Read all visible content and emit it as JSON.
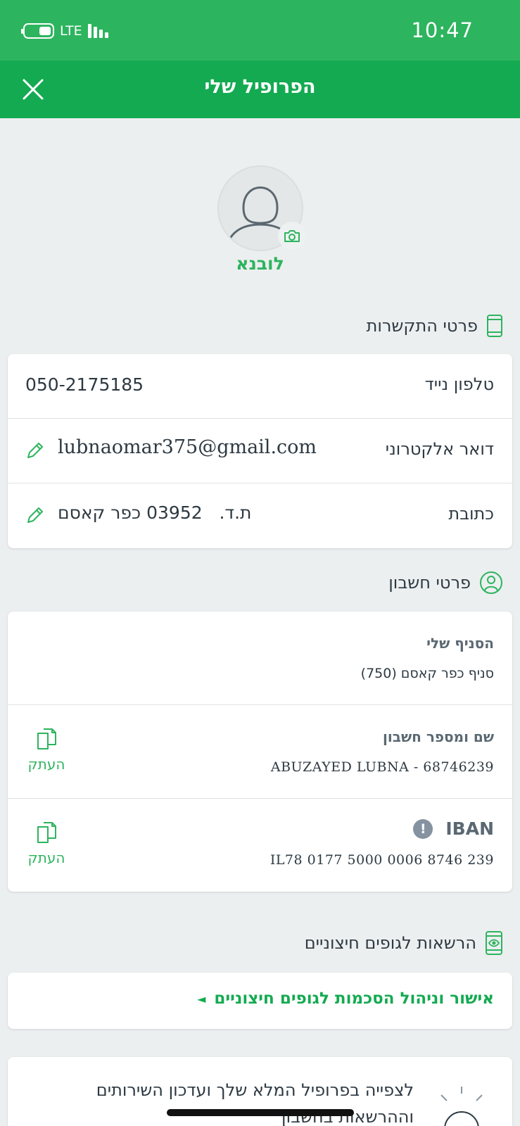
{
  "status_bar": {
    "network": "LTE",
    "time": "10:47"
  },
  "header": {
    "title": "הפרופיל שלי",
    "close_icon": "close-icon"
  },
  "profile": {
    "name": "לובנא",
    "avatar_icon": "user-silhouette-icon",
    "camera_icon": "camera-icon"
  },
  "contact_section": {
    "title": "פרטי התקשרות",
    "icon": "phone-icon",
    "rows": [
      {
        "label": "טלפון נייד",
        "value": "050-2175185"
      },
      {
        "label": "דואר אלקטרוני",
        "value": "lubnaomar375@gmail.com",
        "editable": true
      },
      {
        "label": "כתובת",
        "value": "ת.ד.   03952 כפר קאסם",
        "editable": true
      }
    ]
  },
  "account_section": {
    "title": "פרטי חשבון",
    "icon": "user-circle-icon",
    "branch_label": "הסניף שלי",
    "branch_value": "סניף כפר קאסם (750)",
    "account_label": "שם ומספר חשבון",
    "account_value": "ABUZAYED LUBNA - 68746239",
    "iban_label": "IBAN",
    "iban_value": "IL78 0177 5000 0006 8746 239",
    "info_symbol": "!",
    "copy_label": "העתק"
  },
  "permissions_section": {
    "title": "הרשאות לגופים חיצוניים",
    "icon": "phone-eye-icon",
    "link": "אישור וניהול הסכמות לגופים חיצוניים",
    "link_arrow": "◄"
  },
  "bottom_card": {
    "text": "לצפייה בפרופיל המלא שלך ועדכון השירותים וההרשאות בחשבון",
    "icon": "lightbulb-icon"
  },
  "colors": {
    "status_bar": "#2db45e",
    "header": "#14aa51",
    "accent": "#2db45e",
    "background": "#eceff0"
  }
}
